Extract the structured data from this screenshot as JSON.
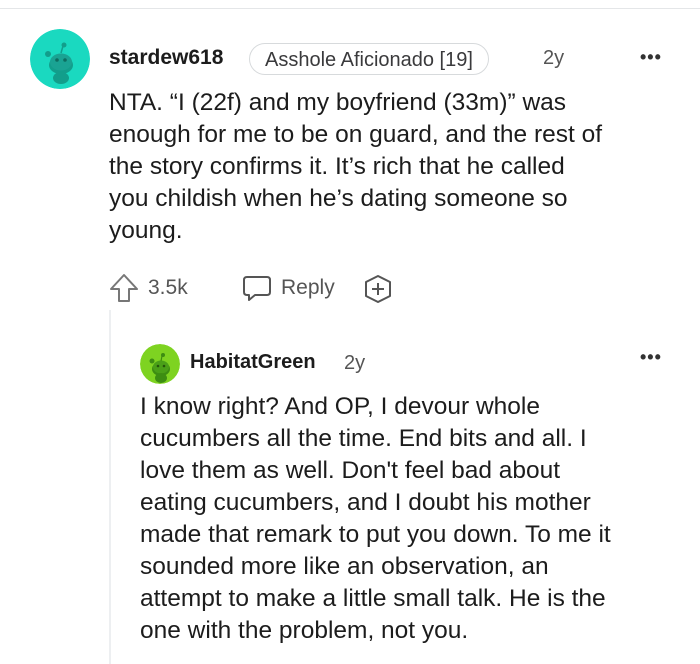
{
  "comment": {
    "username": "stardew618",
    "flair": "Asshole Aficionado [19]",
    "age": "2y",
    "more_icon": "•••",
    "lines": [
      "NTA. “I (22f) and my boyfriend (33m)” was",
      "enough for me to be on guard, and the rest of",
      "the story confirms it. It’s rich that he called",
      "you childish when he’s dating someone so",
      "young."
    ],
    "upvotes": "3.5k",
    "reply_label": "Reply",
    "avatar_color": "#1ad9c0"
  },
  "reply": {
    "username": "HabitatGreen",
    "age": "2y",
    "more_icon": "•••",
    "lines": [
      "I know right? And OP, I devour whole",
      "cucumbers all the time. End bits and all. I",
      "love them as well. Don't feel bad about",
      "eating cucumbers, and I doubt his mother",
      "made that remark to put you down. To me it",
      "sounded more like an observation, an",
      "attempt to make a little small talk. He is the",
      "one with the problem, not you."
    ],
    "avatar_color": "#7ed321"
  }
}
